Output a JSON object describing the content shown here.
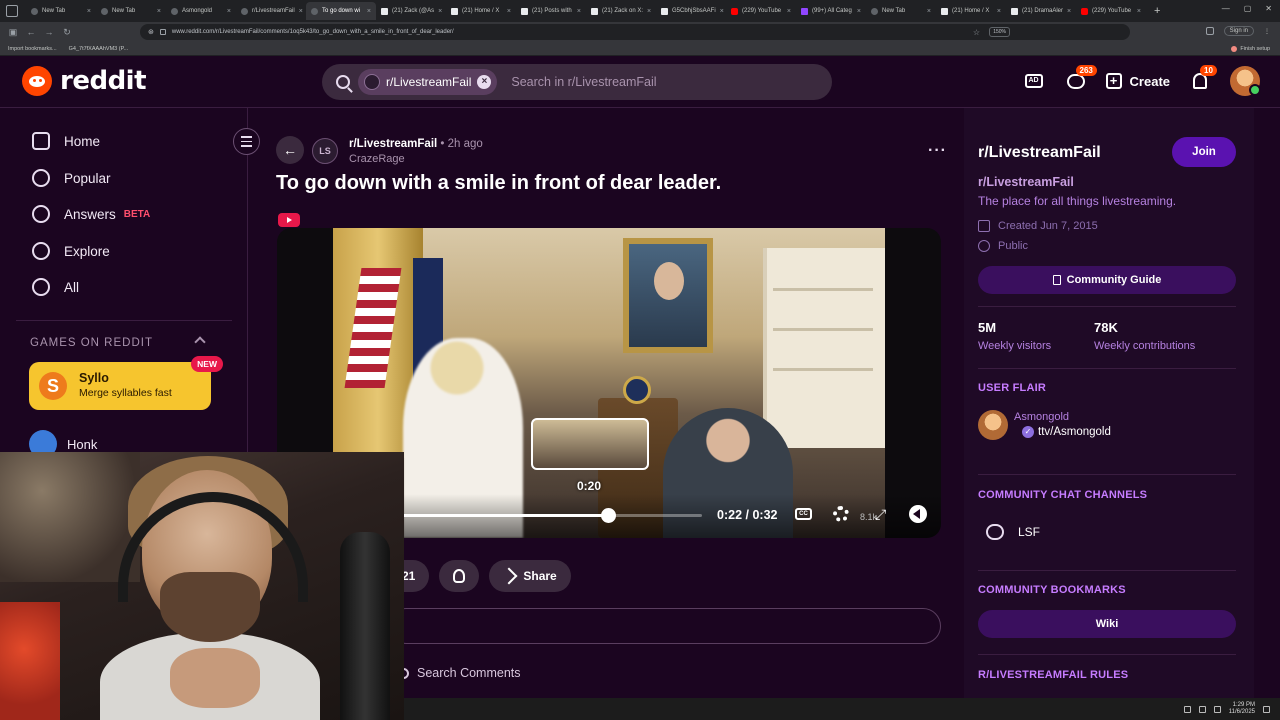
{
  "browser": {
    "tabs": [
      {
        "label": "New Tab",
        "fav": "reddit"
      },
      {
        "label": "New Tab",
        "fav": "reddit"
      },
      {
        "label": "Asmongold",
        "fav": "reddit"
      },
      {
        "label": "r/LivestreamFail",
        "fav": "reddit"
      },
      {
        "label": "To go down wi",
        "fav": "reddit",
        "active": true
      },
      {
        "label": "(21) Zack (@As",
        "fav": "x"
      },
      {
        "label": "(21) Home / X",
        "fav": "x"
      },
      {
        "label": "(21) Posts with",
        "fav": "x"
      },
      {
        "label": "(21) Zack on X:",
        "fav": "x"
      },
      {
        "label": "G5CbhjSbsAAFi",
        "fav": "x"
      },
      {
        "label": "(229) YouTube",
        "fav": "yt"
      },
      {
        "label": "(99+) All Categ",
        "fav": "tw"
      },
      {
        "label": "New Tab",
        "fav": "reddit"
      },
      {
        "label": "(21) Home / X",
        "fav": "x"
      },
      {
        "label": "(21) DramaAler",
        "fav": "x"
      },
      {
        "label": "(229) YouTube",
        "fav": "yt"
      }
    ],
    "url": "www.reddit.com/r/LivestreamFail/comments/1oq5k43/to_go_down_with_a_smile_in_front_of_dear_leader/",
    "zoom": "150%",
    "signin": "Sign in",
    "bookmarks": {
      "import": "Import bookmarks...",
      "second": "G4_7t7fXAAAhVM3 (P...",
      "finish": "Finish setup"
    }
  },
  "header": {
    "logo": "reddit",
    "search_chip": "r/LivestreamFail",
    "search_placeholder": "Search in r/LivestreamFail",
    "chat_badge": "263",
    "create_label": "Create",
    "notif_badge": "10",
    "icons": [
      "advertise-icon",
      "chat-icon",
      "plus-icon",
      "bell-icon",
      "search-icon"
    ]
  },
  "left_nav": {
    "items": [
      {
        "label": "Home",
        "icon": "home-icon"
      },
      {
        "label": "Popular",
        "icon": "popular-icon"
      },
      {
        "label": "Answers",
        "icon": "answers-icon",
        "badge": "BETA"
      },
      {
        "label": "Explore",
        "icon": "explore-icon"
      },
      {
        "label": "All",
        "icon": "all-icon"
      }
    ],
    "games_heading": "GAMES ON REDDIT",
    "syllo": {
      "title": "Syllo",
      "subtitle": "Merge syllables fast",
      "badge": "NEW",
      "logo": "S"
    },
    "honk": "Honk"
  },
  "post": {
    "subreddit": "r/LivestreamFail",
    "sub_icon_text": "LS",
    "time": "2h ago",
    "author": "CrazeRage",
    "title": "To go down with a smile in front of dear leader.",
    "player": {
      "hover_time": "0:20",
      "current_time": "0:22",
      "duration": "0:32",
      "progress": 0.6875,
      "quality": "8.1k"
    },
    "actions": {
      "count": "21",
      "share": "Share"
    },
    "search_comments": "Search Comments"
  },
  "sidebar": {
    "title": "r/LivestreamFail",
    "join": "Join",
    "name": "r/LivestreamFail",
    "description": "The place for all things livestreaming.",
    "created": "Created Jun 7, 2015",
    "visibility": "Public",
    "guide": "Community Guide",
    "stats": [
      {
        "num": "5M",
        "label": "Weekly visitors"
      },
      {
        "num": "78K",
        "label": "Weekly contributions"
      }
    ],
    "user_flair_heading": "USER FLAIR",
    "flair_user": "Asmongold",
    "flair_tag": "ttv/Asmongold",
    "chat_heading": "COMMUNITY CHAT CHANNELS",
    "chat_channel": "LSF",
    "bookmarks_heading": "COMMUNITY BOOKMARKS",
    "wiki": "Wiki",
    "rules_heading": "R/LIVESTREAMFAIL RULES"
  },
  "taskbar": {
    "time": "1:29 PM",
    "date": "11/6/2025"
  },
  "colors": {
    "background": "#1b0520",
    "accent": "#5a12b0",
    "reddit_orange": "#ff4500",
    "sidebar_heading": "#c67cff"
  }
}
